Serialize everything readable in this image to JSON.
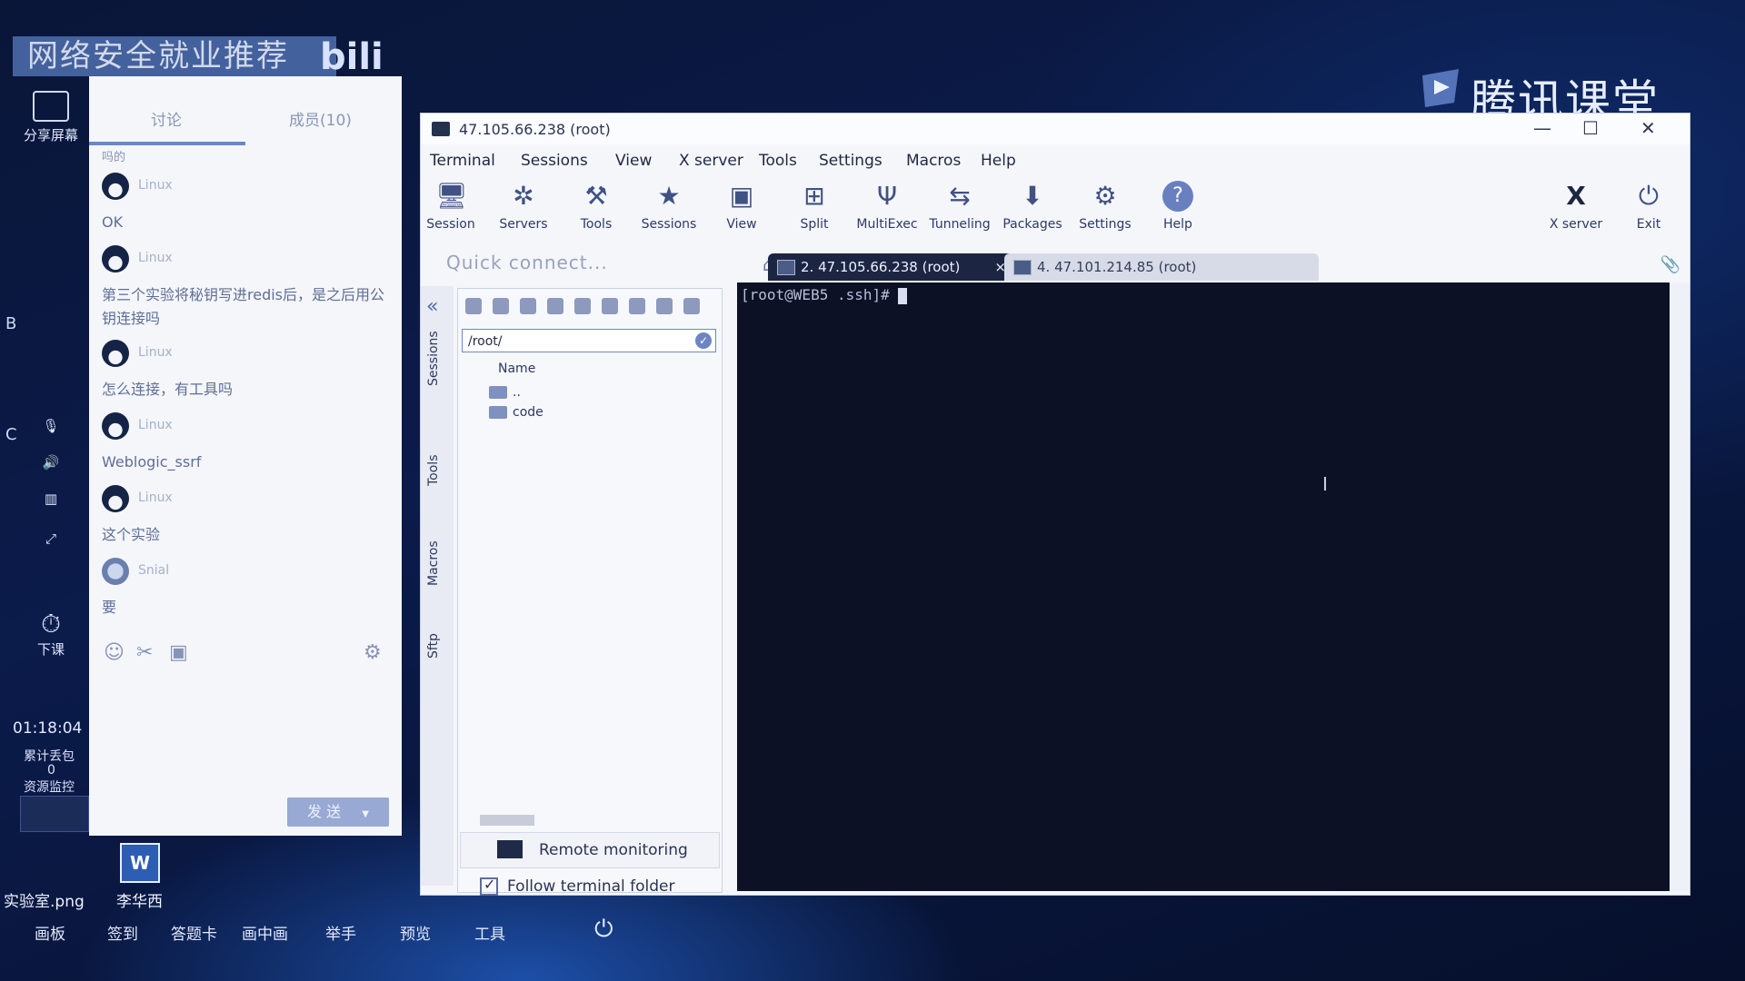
{
  "banner": {
    "title": "网络安全就业推荐",
    "brand": "bili"
  },
  "overlay": {
    "brand": "腾讯课堂"
  },
  "left_bar": {
    "share": "分享屏幕",
    "end_class": "下课",
    "letters": [
      "B",
      "C"
    ],
    "timer": "01:18:04",
    "stat1": "累计丢包",
    "stat1_val": "0",
    "stat2": "资源监控"
  },
  "chat": {
    "tabs": [
      "讨论",
      "成员(10)"
    ],
    "cut_line": "吗的",
    "messages": [
      {
        "name": "Linux",
        "text": "OK"
      },
      {
        "name": "Linux",
        "text": "第三个实验将秘钥写进redis后，是之后用公钥连接吗"
      },
      {
        "name": "Linux",
        "text": "怎么连接，有工具吗"
      },
      {
        "name": "Linux",
        "text": "Weblogic_ssrf"
      },
      {
        "name": "Linux",
        "text": "这个实验"
      },
      {
        "name": "Snial",
        "text": "要"
      }
    ],
    "send_label": "发 送"
  },
  "window": {
    "title": "47.105.66.238 (root)",
    "menu": [
      "Terminal",
      "Sessions",
      "View",
      "X server",
      "Tools",
      "Settings",
      "Macros",
      "Help"
    ],
    "toolbar": [
      "Session",
      "Servers",
      "Tools",
      "Sessions",
      "View",
      "Split",
      "MultiExec",
      "Tunneling",
      "Packages",
      "Settings",
      "Help"
    ],
    "toolbar_right": [
      "X server",
      "Exit"
    ],
    "quick_connect": "Quick connect...",
    "tabs": [
      {
        "label": "2. 47.105.66.238 (root)",
        "active": true
      },
      {
        "label": "4. 47.101.214.85 (root)",
        "active": false
      }
    ],
    "side_tabs": [
      "Sessions",
      "Tools",
      "Macros",
      "Sftp"
    ],
    "sftp": {
      "path": "/root/",
      "column": "Name",
      "files": [
        "..",
        "code"
      ],
      "remote_monitoring": "Remote monitoring",
      "follow_folder": "Follow terminal folder"
    },
    "terminal": {
      "prompt": "[root@WEB5 .ssh]# "
    }
  },
  "desktop": {
    "files": [
      "实验室.png",
      "李华西"
    ]
  },
  "taskbar": [
    "画板",
    "签到",
    "答题卡",
    "画中画",
    "举手",
    "预览",
    "工具"
  ]
}
